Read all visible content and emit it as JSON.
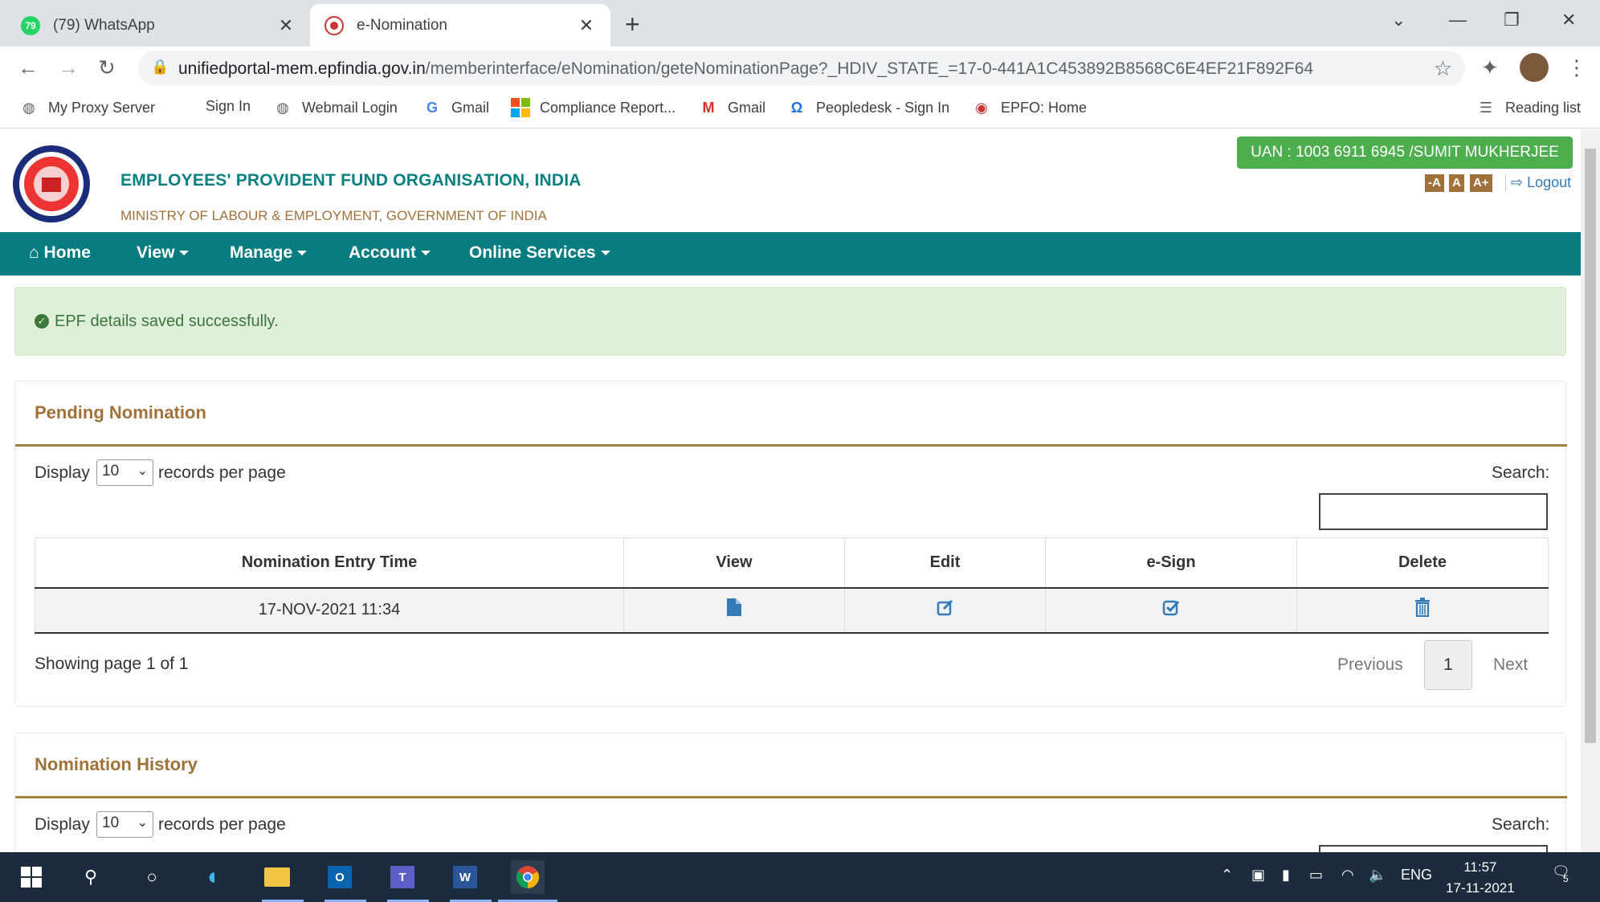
{
  "browser": {
    "tabs": [
      {
        "label": "(79) WhatsApp",
        "badge": "79",
        "active": false
      },
      {
        "label": "e-Nomination",
        "active": true
      }
    ],
    "url_domain": "unifiedportal-mem.epfindia.gov.in",
    "url_path": "/memberinterface/eNomination/geteNominationPage?_HDIV_STATE_=17-0-441A1C453892B8568C6E4EF21F892F64",
    "bookmarks": [
      "My Proxy Server",
      "Sign In",
      "Webmail Login",
      "Gmail",
      "Compliance Report...",
      "Gmail",
      "Peopledesk - Sign In",
      "EPFO: Home"
    ],
    "reading_list": "Reading list"
  },
  "header": {
    "org_name": "EMPLOYEES' PROVIDENT FUND ORGANISATION, INDIA",
    "ministry": "MINISTRY OF LABOUR & EMPLOYMENT, GOVERNMENT OF INDIA",
    "uan": "UAN : 1003 6911 6945 /SUMIT MUKHERJEE",
    "font_sizes": [
      "-A",
      "A",
      "A+"
    ],
    "logout": "Logout"
  },
  "nav": {
    "home": "Home",
    "view": "View",
    "manage": "Manage",
    "account": "Account",
    "online_services": "Online Services"
  },
  "alert": {
    "message": "EPF details saved successfully."
  },
  "pending": {
    "title": "Pending Nomination",
    "display": "Display",
    "per_page": "10",
    "records_per_page": "records per page",
    "search_label": "Search:",
    "columns": [
      "Nomination Entry Time",
      "View",
      "Edit",
      "e-Sign",
      "Delete"
    ],
    "rows": [
      {
        "entry_time": "17-NOV-2021 11:34"
      }
    ],
    "showing": "Showing page 1 of 1",
    "previous": "Previous",
    "page": "1",
    "next": "Next"
  },
  "history": {
    "title": "Nomination History",
    "display": "Display",
    "per_page": "10",
    "records_per_page": "records per page",
    "search_label": "Search:"
  },
  "taskbar": {
    "lang": "ENG",
    "time": "11:57",
    "date": "17-11-2021",
    "notifications": "5"
  },
  "colors": {
    "teal": "#077d82",
    "gold": "#a0723a",
    "success_bg": "#dff0d8",
    "uan_green": "#4cae4c"
  }
}
